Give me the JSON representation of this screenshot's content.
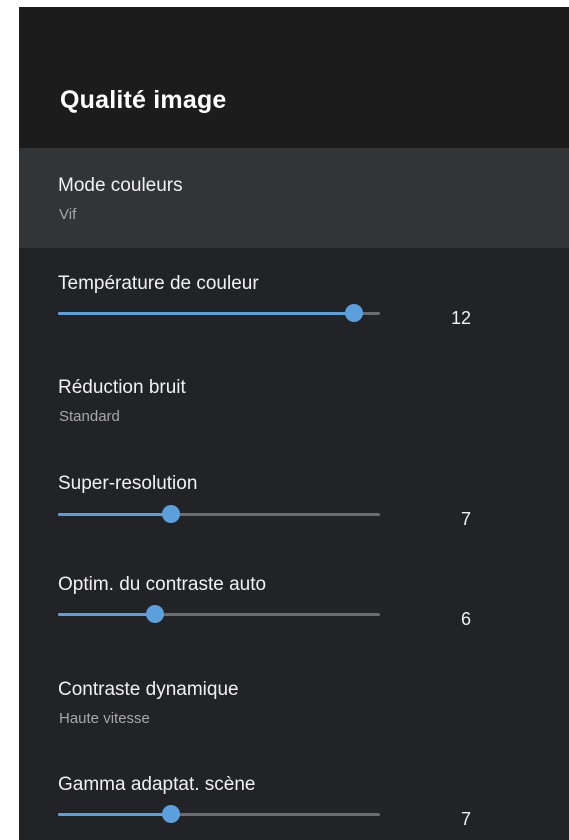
{
  "panel": {
    "title": "Qualité image"
  },
  "colors": {
    "panel_bg": "#222326",
    "header_bg": "#1c1c1d",
    "selected_bg": "#333437",
    "accent": "#5b9fdd",
    "track": "#6b6c70"
  },
  "items": [
    {
      "label": "Mode couleurs",
      "value": "Vif",
      "selected": true
    },
    {
      "label": "Température de couleur",
      "slider_value": "12",
      "slider_fraction": 0.92
    },
    {
      "label": "Réduction bruit",
      "value": "Standard"
    },
    {
      "label": "Super-resolution",
      "slider_value": "7",
      "slider_fraction": 0.35
    },
    {
      "label": "Optim. du contraste auto",
      "slider_value": "6",
      "slider_fraction": 0.3
    },
    {
      "label": "Contraste dynamique",
      "value": "Haute vitesse"
    },
    {
      "label": "Gamma adaptat. scène",
      "slider_value": "7",
      "slider_fraction": 0.35
    }
  ]
}
